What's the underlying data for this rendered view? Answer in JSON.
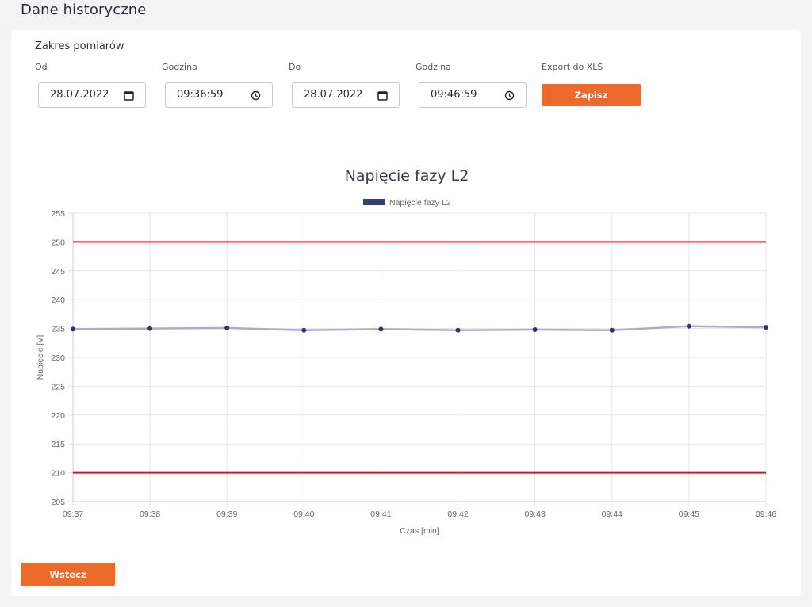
{
  "page": {
    "title": "Dane historyczne"
  },
  "range": {
    "title": "Zakres pomiarów",
    "from_label": "Od",
    "from_date": "28.07.2022",
    "from_time_label": "Godzina",
    "from_time": "09:36:59",
    "to_label": "Do",
    "to_date": "28.07.2022",
    "to_time_label": "Godzina",
    "to_time": "09:46:59",
    "export_label": "Export do XLS",
    "save_label": "Zapisz"
  },
  "footer": {
    "back_label": "Wstecz"
  },
  "icons": {
    "date": "calendar-icon",
    "time": "clock-icon"
  },
  "colors": {
    "accent": "#ec6a2b",
    "series_line": "#a9adc9",
    "series_point": "#2e3660",
    "legend_swatch": "#34406e",
    "threshold": "#e0101e"
  },
  "chart_data": {
    "type": "line",
    "title": "Napięcie fazy L2",
    "xlabel": "Czas [min]",
    "ylabel": "Napięcie [V]",
    "categories": [
      "09:37",
      "09:38",
      "09:39",
      "09:40",
      "09:41",
      "09:42",
      "09:43",
      "09:44",
      "09:45",
      "09:46"
    ],
    "series": [
      {
        "name": "Napięcie fazy L2",
        "values": [
          234.9,
          235.0,
          235.1,
          234.7,
          234.9,
          234.7,
          234.8,
          234.7,
          235.4,
          235.2
        ]
      }
    ],
    "thresholds": [
      250,
      210
    ],
    "ylim": [
      205,
      255
    ],
    "yticks": [
      205,
      210,
      215,
      220,
      225,
      230,
      235,
      240,
      245,
      250,
      255
    ],
    "grid": true,
    "legend_position": "top-center"
  }
}
